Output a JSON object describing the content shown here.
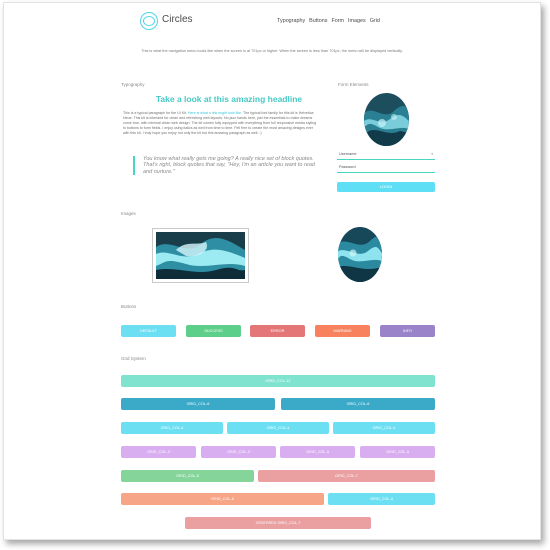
{
  "header": {
    "brand": "Circles",
    "nav": [
      "Typography",
      "Buttons",
      "Form",
      "Images",
      "Grid"
    ]
  },
  "intro": "This is what the navigation menu looks like when the screen is at 701px or higher. When the screen is less than 701px, the menu will be displayed vertically.",
  "typography": {
    "section_title": "Typography",
    "headline": "Take a look at this amazing headline",
    "para_start": "This is a typical paragraph for the UI Kit.",
    "para_link": "Here is what a link might look like.",
    "para_rest": "The typical font family for this kit is Helvetica Neue. This kit is intended for clean and refreshing web layouts. No jazz hands here, just the essentials to make dreams come true, with minimal clean web design. The kit comes fully equipped with everything from full responsive media styling to buttons to form fields. I enjoy using italics as well from time to time. Fell free to create the most amazing designs ever with this kit. I truly hope you enjoy not only the kit but this amazing paragraph as well. :)",
    "blockquote": "You know what really gets me going? A really nice set of block quotes. That's right, block quotes that say, \"Hey, I'm an article you want to read and nurture.\""
  },
  "form": {
    "section_title": "Form Elements",
    "username": "Username",
    "password": "Password",
    "login": "LOGIN"
  },
  "images": {
    "section_title": "Images"
  },
  "buttons": {
    "section_title": "Buttons",
    "items": [
      {
        "label": "DEFAULT",
        "color": "#6ddff2"
      },
      {
        "label": "SUCCESS",
        "color": "#5dcf8a"
      },
      {
        "label": "ERROR",
        "color": "#e47678"
      },
      {
        "label": "WARNING",
        "color": "#f7825d"
      },
      {
        "label": "INFO",
        "color": "#9a83c9"
      }
    ]
  },
  "grid": {
    "section_title": "Grid System",
    "rows": [
      [
        "GRID_COL-12"
      ],
      [
        "GRID_COL-6",
        "GRID_COL-6"
      ],
      [
        "GRID_COL-4",
        "GRID_COL-4",
        "GRID_COL-4"
      ],
      [
        "GRID_COL-3",
        "GRID_COL-3",
        "GRID_COL-3",
        "GRID_COL-3"
      ],
      [
        "GRID_COL-5",
        "GRID_COL-7"
      ],
      [
        "GRID_COL-8",
        "GRID_COL-4"
      ],
      [
        "CENTERED GRID_COL-7"
      ]
    ]
  },
  "colors": {
    "accent": "#46c9c4",
    "col12": "#7fe3cf",
    "col6": "#3aaac8",
    "col4": "#6ddff2",
    "col3": "#d9aef0",
    "col5": "#85d49a",
    "col7": "#eaa0a1",
    "col8": "#f7a587"
  }
}
